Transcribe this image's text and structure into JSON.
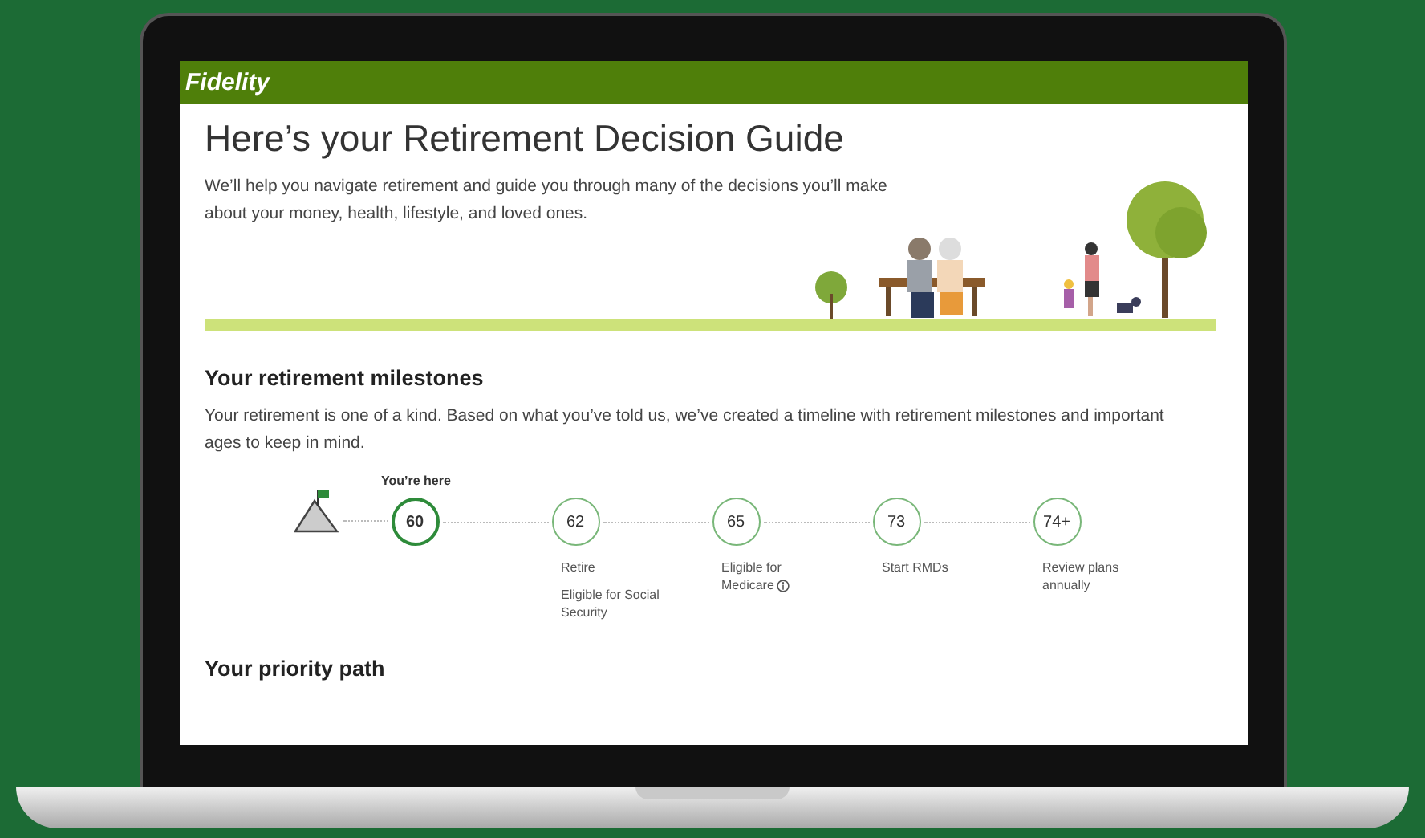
{
  "brand": {
    "logo": "Fidelity"
  },
  "hero": {
    "title": "Here’s your Retirement Decision Guide",
    "intro": "We’ll help you navigate retirement and guide you through many of the decisions you’ll make about your money, health, lifestyle, and loved ones."
  },
  "milestones": {
    "heading": "Your retirement milestones",
    "description": "Your retirement is one of a kind. Based on what you’ve told us, we’ve created a timeline with retirement milestones and important ages to keep in mind.",
    "current_label": "You’re here",
    "items": [
      {
        "age": "60",
        "selected": true
      },
      {
        "age": "62",
        "selected": false,
        "labels": [
          "Retire",
          "Eligible for Social Security"
        ]
      },
      {
        "age": "65",
        "selected": false,
        "labels": [
          "Eligible for Medicare"
        ],
        "info": true
      },
      {
        "age": "73",
        "selected": false,
        "labels": [
          "Start RMDs"
        ]
      },
      {
        "age": "74+",
        "selected": false,
        "labels": [
          "Review plans annually"
        ]
      }
    ]
  },
  "priority": {
    "heading": "Your priority path"
  }
}
